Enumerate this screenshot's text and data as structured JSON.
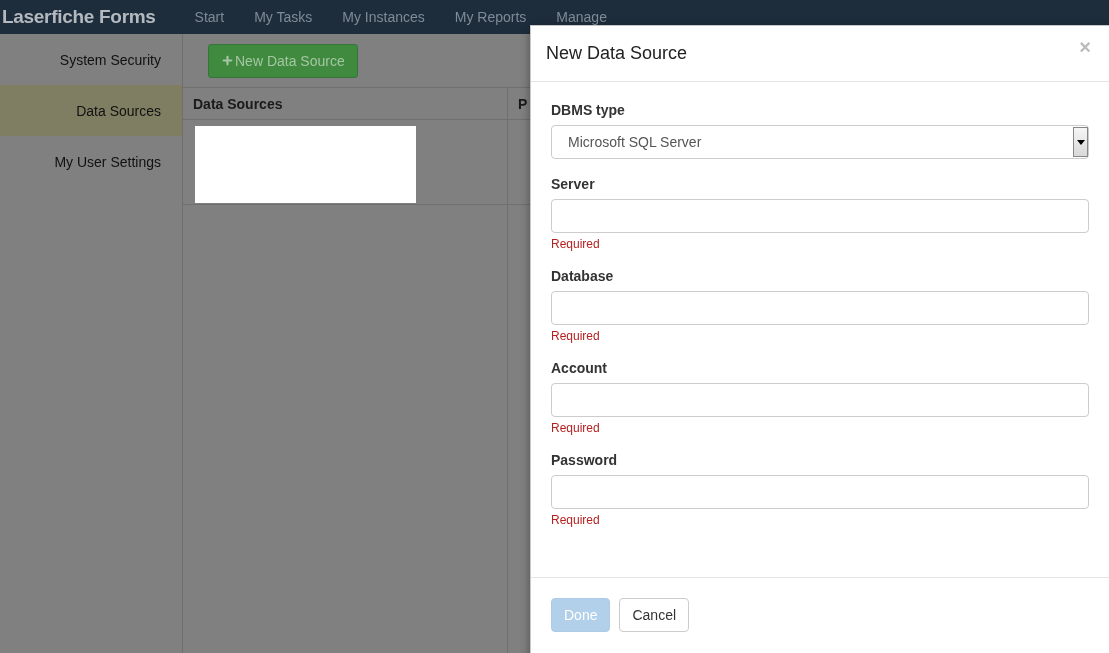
{
  "header": {
    "brand": "Laserfiche Forms",
    "nav": [
      {
        "label": "Start"
      },
      {
        "label": "My Tasks"
      },
      {
        "label": "My Instances"
      },
      {
        "label": "My Reports"
      },
      {
        "label": "Manage"
      }
    ]
  },
  "sidebar": {
    "items": [
      {
        "label": "System Security",
        "selected": false
      },
      {
        "label": "Data Sources",
        "selected": true
      },
      {
        "label": "My User Settings",
        "selected": false
      }
    ]
  },
  "toolbar": {
    "new_button": "New Data Source"
  },
  "table": {
    "columns": [
      "Data Sources",
      "P"
    ],
    "rows": [
      {
        "redacted": true
      }
    ]
  },
  "modal": {
    "title": "New Data Source",
    "close": "×",
    "fields": [
      {
        "kind": "select",
        "label": "DBMS type",
        "value": "Microsoft SQL Server"
      },
      {
        "kind": "text",
        "label": "Server",
        "error": "Required"
      },
      {
        "kind": "text",
        "label": "Database",
        "error": "Required"
      },
      {
        "kind": "text",
        "label": "Account",
        "error": "Required"
      },
      {
        "kind": "password",
        "label": "Password",
        "error": "Required"
      }
    ],
    "buttons": [
      {
        "label": "Done",
        "kind": "primary",
        "disabled": true
      },
      {
        "label": "Cancel",
        "kind": "default",
        "disabled": false
      }
    ]
  }
}
